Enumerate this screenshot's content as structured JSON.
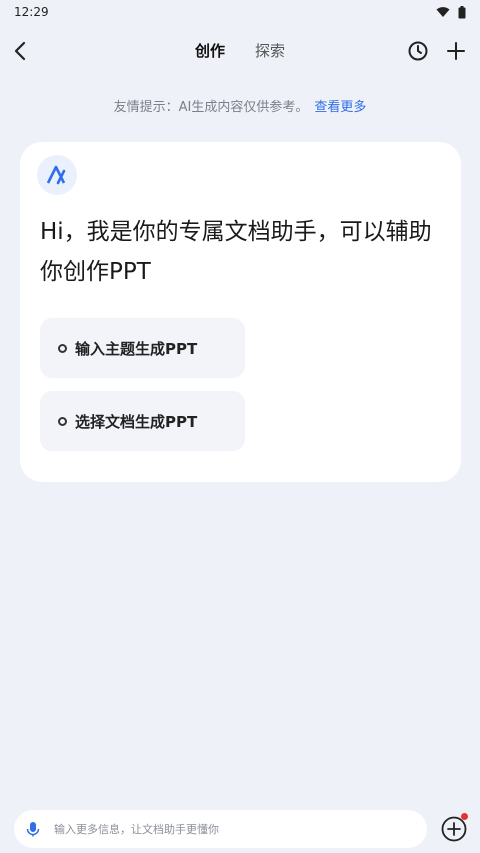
{
  "status_bar": {
    "time": "12:29"
  },
  "header": {
    "tabs": [
      {
        "label": "创作",
        "active": true
      },
      {
        "label": "探索",
        "active": false
      }
    ]
  },
  "tip": {
    "text": "友情提示：AI生成内容仅供参考。",
    "link": "查看更多"
  },
  "card": {
    "greeting": "Hi，我是你的专属文档助手，可以辅助你创作PPT",
    "options": [
      {
        "label": "输入主题生成PPT"
      },
      {
        "label": "选择文档生成PPT"
      }
    ]
  },
  "input": {
    "placeholder": "输入更多信息，让文档助手更懂你"
  },
  "colors": {
    "accent": "#2f6ee8",
    "background": "#eff1f8",
    "card": "#ffffff",
    "badge": "#e8322d"
  },
  "icons": [
    "back-icon",
    "history-icon",
    "add-icon",
    "mic-icon",
    "plus-circle-icon",
    "wifi-icon",
    "battery-icon",
    "app-logo-icon"
  ]
}
